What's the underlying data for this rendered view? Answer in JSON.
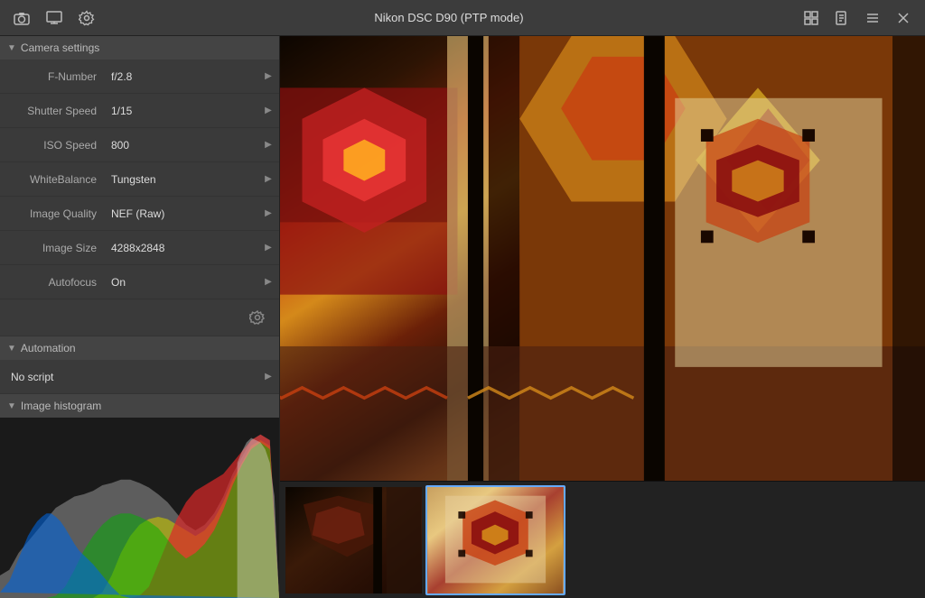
{
  "titlebar": {
    "title": "Nikon DSC D90 (PTP mode)",
    "icons": {
      "camera": "📷",
      "display": "🖥",
      "settings": "⚙"
    },
    "buttons": {
      "add_label": "⊞",
      "doc_label": "📄",
      "menu_label": "≡",
      "close_label": "✕"
    }
  },
  "camera_settings": {
    "section_label": "Camera settings",
    "rows": [
      {
        "label": "F-Number",
        "value": "f/2.8"
      },
      {
        "label": "Shutter Speed",
        "value": "1/15"
      },
      {
        "label": "ISO Speed",
        "value": "800"
      },
      {
        "label": "WhiteBalance",
        "value": "Tungsten"
      },
      {
        "label": "Image Quality",
        "value": "NEF (Raw)"
      },
      {
        "label": "Image Size",
        "value": "4288x2848"
      },
      {
        "label": "Autofocus",
        "value": "On"
      }
    ]
  },
  "automation": {
    "section_label": "Automation",
    "script_value": "No script"
  },
  "histogram": {
    "section_label": "Image histogram"
  },
  "thumbnails": [
    {
      "id": 1,
      "selected": false
    },
    {
      "id": 2,
      "selected": true
    }
  ]
}
